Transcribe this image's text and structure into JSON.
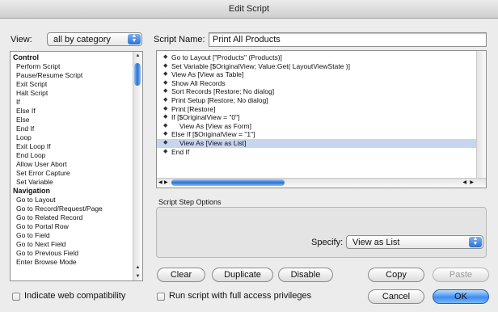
{
  "window": {
    "title": "Edit Script"
  },
  "view": {
    "label": "View:",
    "selected": "all by category"
  },
  "step_list": {
    "items": [
      {
        "label": "Control",
        "category": true
      },
      {
        "label": "Perform Script",
        "category": false
      },
      {
        "label": "Pause/Resume Script",
        "category": false
      },
      {
        "label": "Exit Script",
        "category": false
      },
      {
        "label": "Halt Script",
        "category": false
      },
      {
        "label": "If",
        "category": false
      },
      {
        "label": "Else If",
        "category": false
      },
      {
        "label": "Else",
        "category": false
      },
      {
        "label": "End If",
        "category": false
      },
      {
        "label": "Loop",
        "category": false
      },
      {
        "label": "Exit Loop If",
        "category": false
      },
      {
        "label": "End Loop",
        "category": false
      },
      {
        "label": "Allow User Abort",
        "category": false
      },
      {
        "label": "Set Error Capture",
        "category": false
      },
      {
        "label": "Set Variable",
        "category": false
      },
      {
        "label": "Navigation",
        "category": true
      },
      {
        "label": "Go to Layout",
        "category": false
      },
      {
        "label": "Go to Record/Request/Page",
        "category": false
      },
      {
        "label": "Go to Related Record",
        "category": false
      },
      {
        "label": "Go to Portal Row",
        "category": false
      },
      {
        "label": "Go to Field",
        "category": false
      },
      {
        "label": "Go to Next Field",
        "category": false
      },
      {
        "label": "Go to Previous Field",
        "category": false
      },
      {
        "label": "Enter Browse Mode",
        "category": false
      }
    ]
  },
  "script_name": {
    "label": "Script Name:",
    "value": "Print All Products"
  },
  "script_steps": [
    {
      "text": "Go to Layout [\"Products\" (Products)]",
      "indent": 0,
      "selected": false
    },
    {
      "text": "Set Variable [$OriginalView; Value:Get( LayoutViewState )]",
      "indent": 0,
      "selected": false
    },
    {
      "text": "View As [View as Table]",
      "indent": 0,
      "selected": false
    },
    {
      "text": "Show All Records",
      "indent": 0,
      "selected": false
    },
    {
      "text": "Sort Records [Restore; No dialog]",
      "indent": 0,
      "selected": false
    },
    {
      "text": "Print Setup [Restore; No dialog]",
      "indent": 0,
      "selected": false
    },
    {
      "text": "Print [Restore]",
      "indent": 0,
      "selected": false
    },
    {
      "text": "If [$OriginalView = \"0\"]",
      "indent": 0,
      "selected": false
    },
    {
      "text": "View As [View as Form]",
      "indent": 1,
      "selected": false
    },
    {
      "text": "Else If [$OriginalView = \"1\"]",
      "indent": 0,
      "selected": false
    },
    {
      "text": "View As [View as List]",
      "indent": 1,
      "selected": true
    },
    {
      "text": "End If",
      "indent": 0,
      "selected": false
    }
  ],
  "options": {
    "title": "Script Step Options",
    "specify_label": "Specify:",
    "specify_value": "View as List"
  },
  "buttons": {
    "clear": "Clear",
    "duplicate": "Duplicate",
    "disable": "Disable",
    "copy": "Copy",
    "paste": "Paste",
    "cancel": "Cancel",
    "ok": "OK"
  },
  "checkboxes": {
    "web_compat": "Indicate web compatibility",
    "full_access": "Run script with full access privileges"
  },
  "colors": {
    "selection": "#c7d6ee",
    "aqua_blue": "#2c6fd4"
  }
}
